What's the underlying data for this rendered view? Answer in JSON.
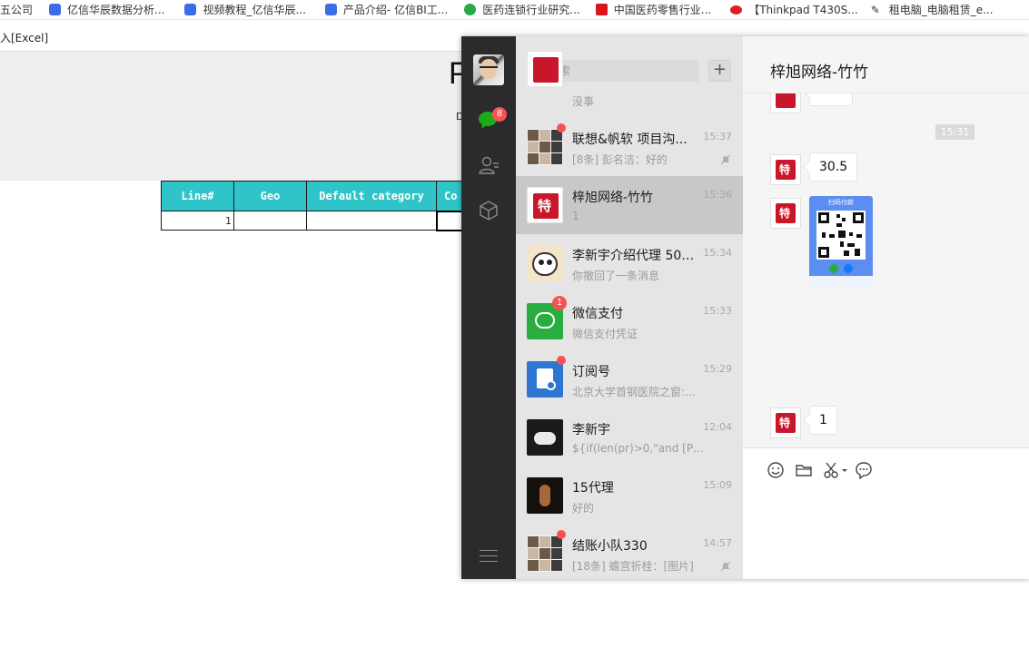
{
  "browser": {
    "bookmarks": [
      {
        "label": "五公司",
        "icon": "none"
      },
      {
        "label": "亿信华辰数据分析...",
        "icon": "yixin-logo-icon"
      },
      {
        "label": "视频教程_亿信华辰...",
        "icon": "yixin-logo-icon"
      },
      {
        "label": "产品介绍- 亿信BI工...",
        "icon": "yixin-logo-icon"
      },
      {
        "label": "医药连锁行业研究...",
        "icon": "green-logo-icon"
      },
      {
        "label": "中国医药零售行业...",
        "icon": "red-logo-icon"
      },
      {
        "label": "【Thinkpad T430S...",
        "icon": "lenovo-logo-icon"
      },
      {
        "label": "租电脑_电脑租赁_e...",
        "icon": "wrench-icon"
      }
    ]
  },
  "report": {
    "tab_label": "入[Excel]",
    "big_letter": "P",
    "small_text": "D",
    "table": {
      "headers": [
        "Line#",
        "Geo",
        "Default category",
        "Co"
      ],
      "rows": [
        [
          "1",
          "",
          "",
          ""
        ]
      ]
    }
  },
  "wechat": {
    "nav": {
      "chat_badge": "8"
    },
    "search": {
      "placeholder": "搜索"
    },
    "plus_label": "+",
    "conversations": [
      {
        "name": "",
        "preview": "没事",
        "time": "",
        "thumb": "red",
        "badge": "",
        "dot": false,
        "muted": false
      },
      {
        "name": "联想&帆软 项目沟...",
        "preview": "[8条] 彭名洁：好的",
        "time": "15:37",
        "thumb": "collage",
        "badge": "",
        "dot": true,
        "muted": true
      },
      {
        "name": "梓旭网络-竹竹",
        "preview": "1",
        "time": "15:36",
        "thumb": "red",
        "badge": "",
        "dot": false,
        "muted": false,
        "active": true
      },
      {
        "name": "李新宇介绍代理 50张...",
        "preview": "你撤回了一条消息",
        "time": "15:34",
        "thumb": "cartoon",
        "badge": "",
        "dot": false,
        "muted": false
      },
      {
        "name": "微信支付",
        "preview": "微信支付凭证",
        "time": "15:33",
        "thumb": "green",
        "badge": "1",
        "dot": false,
        "muted": false
      },
      {
        "name": "订阅号",
        "preview": "北京大学首钢医院之窗:...",
        "time": "15:29",
        "thumb": "blue",
        "badge": "",
        "dot": true,
        "muted": false
      },
      {
        "name": "李新宇",
        "preview": "${if(len(pr)>0,\"and [PR ...",
        "time": "12:04",
        "thumb": "bw",
        "badge": "",
        "dot": false,
        "muted": false
      },
      {
        "name": "15代理",
        "preview": "好的",
        "time": "15:09",
        "thumb": "night",
        "badge": "",
        "dot": false,
        "muted": false
      },
      {
        "name": "结账小队330",
        "preview": "[18条] 蟾宫折桂：[图片]",
        "time": "14:57",
        "thumb": "collage",
        "badge": "",
        "dot": true,
        "muted": true
      }
    ],
    "chat": {
      "title": "梓旭网络-竹竹",
      "time_chip": "15:31",
      "messages": [
        "30.5",
        "1"
      ],
      "avatar_glyph": "特",
      "qr_top_text": "扫码付款"
    }
  }
}
